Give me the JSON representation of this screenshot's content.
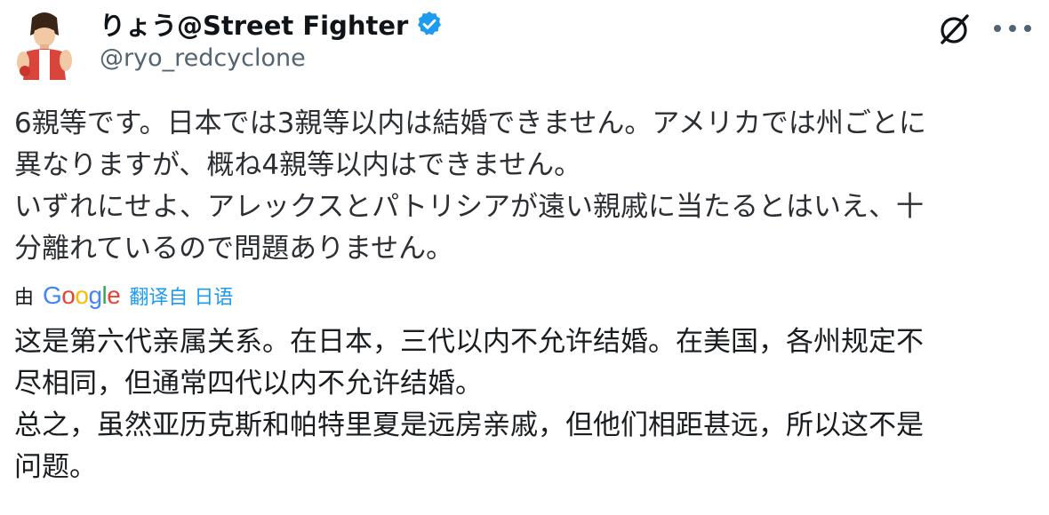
{
  "author": {
    "display_name": "りょう@Street Fighter",
    "handle": "@ryo_redcyclone",
    "verified": true,
    "avatar_icon": "avatar-character-icon"
  },
  "header_actions": {
    "grok_icon": "grok-slash-icon",
    "more_icon": "more-horizontal-icon"
  },
  "tweet": {
    "lines": [
      "6親等です。日本では3親等以内は結婚できません。アメリカでは州ごとに",
      "異なりますが、概ね4親等以内はできません。",
      "いずれにせよ、アレックスとパトリシアが遠い親戚に当たるとはいえ、十",
      "分離れているので問題ありません。"
    ]
  },
  "translation": {
    "by_label": "由",
    "provider": "Google",
    "link_label": "翻译自 日语",
    "google_colors": [
      "#4285F4",
      "#EA4335",
      "#FBBC05",
      "#4285F4",
      "#34A853",
      "#EA4335"
    ],
    "lines": [
      "这是第六代亲属关系。在日本，三代以内不允许结婚。在美国，各州规定不",
      "尽相同，但通常四代以内不允许结婚。",
      "总之，虽然亚历克斯和帕特里夏是远房亲戚，但他们相距甚远，所以这不是",
      "问题。"
    ]
  },
  "colors": {
    "text_primary": "#0f1419",
    "text_secondary": "#536471",
    "link": "#1d9bf0",
    "verified": "#1d9bf0"
  }
}
